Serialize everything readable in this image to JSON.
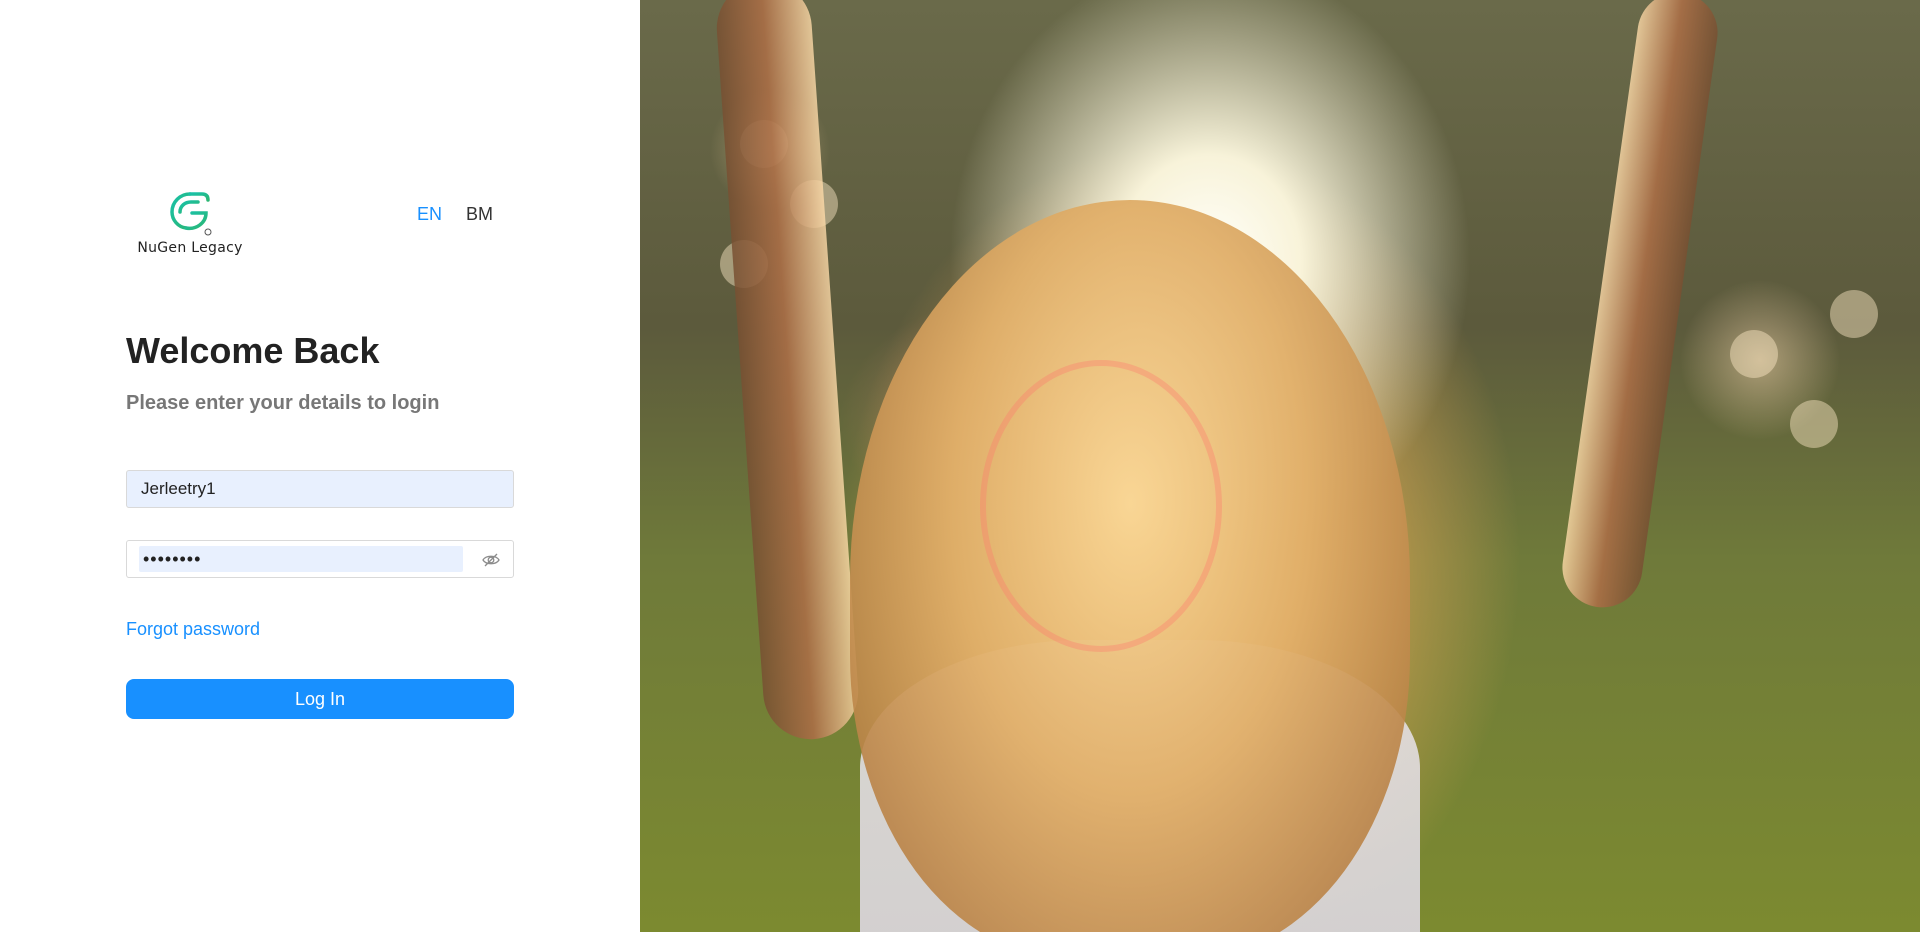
{
  "brand": {
    "name": "NuGen Legacy",
    "primary_color": "#1890ff",
    "logo_colors": [
      "#19c1a7",
      "#2bb673"
    ]
  },
  "language": {
    "options": [
      "EN",
      "BM"
    ],
    "selected": "EN"
  },
  "login": {
    "title": "Welcome Back",
    "subtitle": "Please enter your details to login",
    "username_value": "Jerleetry1",
    "password_value": "••••••••",
    "forgot_label": "Forgot password",
    "submit_label": "Log In"
  },
  "hero": {
    "icon": "photo-woman-arms-raised-sunlight"
  }
}
